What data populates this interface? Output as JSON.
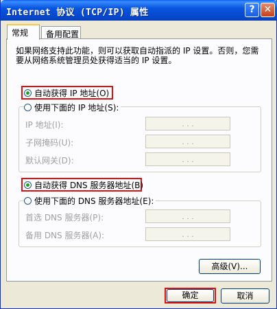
{
  "window": {
    "title": "Internet 协议 (TCP/IP) 属性"
  },
  "titlebar": {
    "help_label": "?",
    "close_label": "✕"
  },
  "tabs": [
    {
      "label": "常规"
    },
    {
      "label": "备用配置"
    }
  ],
  "general": {
    "description": "如果网络支持此功能，则可以获取自动指派的 IP 设置。否则，您需要从网络系统管理员处获得适当的 IP 设置。",
    "ip_auto_label": "自动获得 IP 地址(O)",
    "ip_manual_label": "使用下面的 IP 地址(S):",
    "ip_fields": [
      {
        "label": "IP 地址(I):",
        "value": ".   .   ."
      },
      {
        "label": "子网掩码(U):",
        "value": ".   .   ."
      },
      {
        "label": "默认网关(D):",
        "value": ".   .   ."
      }
    ],
    "dns_auto_label": "自动获得 DNS 服务器地址(B)",
    "dns_manual_label": "使用下面的 DNS 服务器地址(E):",
    "dns_fields": [
      {
        "label": "首选 DNS 服务器(P):",
        "value": ".   .   ."
      },
      {
        "label": "备用 DNS 服务器(A):",
        "value": ".   .   ."
      }
    ],
    "advanced_label": "高级(V)..."
  },
  "footer": {
    "ok_label": "确定",
    "cancel_label": "取消"
  },
  "ip_mode_selected": "auto",
  "dns_mode_selected": "auto",
  "colors": {
    "highlight": "#e01010",
    "titlebar": "#0855dd"
  }
}
